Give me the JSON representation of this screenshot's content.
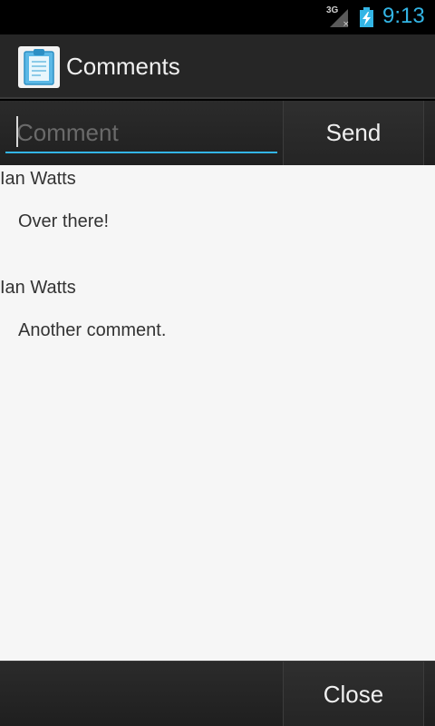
{
  "status_bar": {
    "network": "3G",
    "time": "9:13",
    "accent_color": "#33b5e5"
  },
  "action_bar": {
    "title": "Comments",
    "icon": "clipboard-icon"
  },
  "compose": {
    "placeholder": "Comment",
    "value": "",
    "send_label": "Send"
  },
  "comments": [
    {
      "author": "Ian Watts",
      "text": "Over there!"
    },
    {
      "author": "Ian Watts",
      "text": "Another comment."
    }
  ],
  "bottom_bar": {
    "close_label": "Close"
  }
}
